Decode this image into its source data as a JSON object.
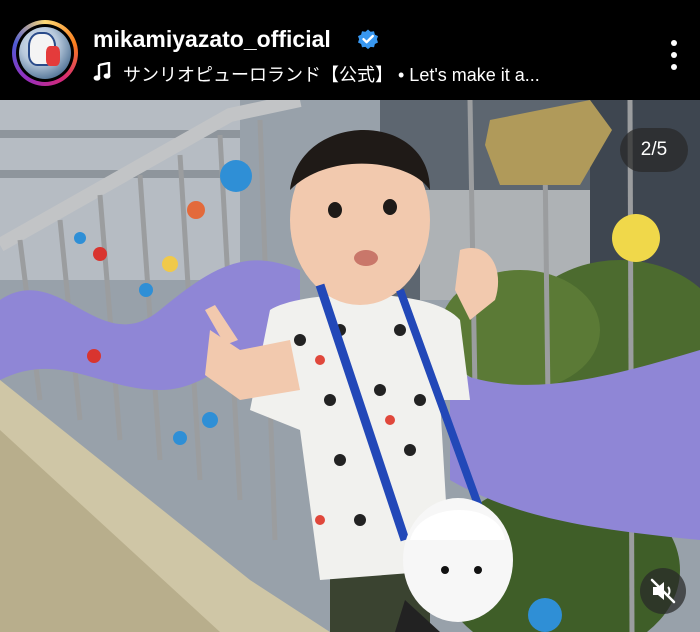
{
  "header": {
    "username": "mikamiyazato_official",
    "audio_text": "サンリオピューロランド【公式】 • Let's make it a...",
    "verified_icon": "verified-badge-icon",
    "music_icon": "music-note-icon",
    "more_icon": "more-options-icon"
  },
  "media": {
    "counter": "2/5",
    "mute_icon": "muted-speaker-icon"
  },
  "colors": {
    "verified": "#3897f0",
    "background": "#000000",
    "wave_rail": "#8f86d6"
  }
}
